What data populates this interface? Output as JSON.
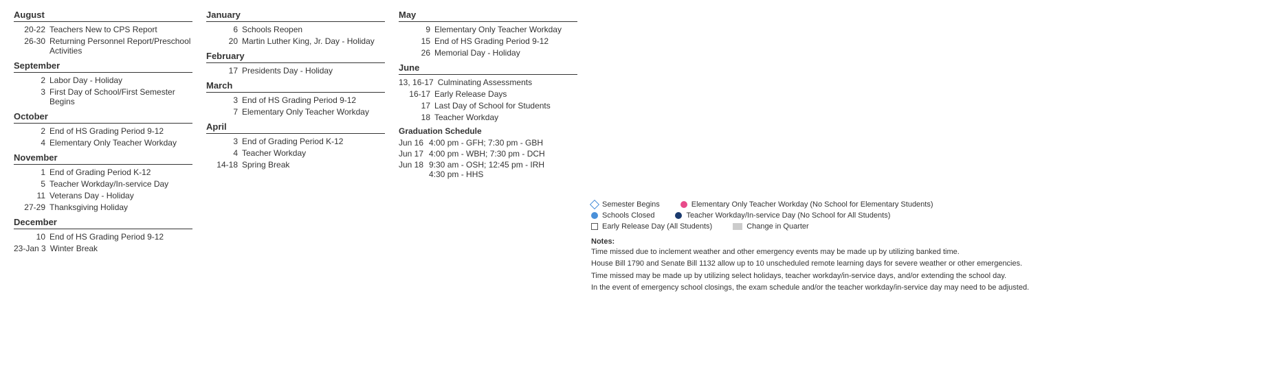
{
  "calendar": {
    "left": {
      "months": [
        {
          "name": "August",
          "events": [
            {
              "date": "20-22",
              "desc": "Teachers New to CPS Report"
            },
            {
              "date": "26-30",
              "desc": "Returning Personnel Report/Preschool Activities"
            }
          ]
        },
        {
          "name": "September",
          "events": [
            {
              "date": "2",
              "desc": "Labor Day - Holiday"
            },
            {
              "date": "3",
              "desc": "First Day of School/First Semester Begins"
            }
          ]
        },
        {
          "name": "October",
          "events": [
            {
              "date": "2",
              "desc": "End of HS Grading Period 9-12"
            },
            {
              "date": "4",
              "desc": "Elementary Only Teacher Workday"
            }
          ]
        },
        {
          "name": "November",
          "events": [
            {
              "date": "1",
              "desc": "End of Grading Period K-12"
            },
            {
              "date": "5",
              "desc": "Teacher Workday/In-service Day"
            },
            {
              "date": "11",
              "desc": "Veterans Day - Holiday"
            },
            {
              "date": "27-29",
              "desc": "Thanksgiving Holiday"
            }
          ]
        },
        {
          "name": "December",
          "events": [
            {
              "date": "10",
              "desc": "End of HS Grading Period 9-12"
            },
            {
              "date": "23-Jan 3",
              "desc": "Winter Break"
            }
          ]
        }
      ]
    },
    "mid": {
      "months": [
        {
          "name": "January",
          "events": [
            {
              "date": "6",
              "desc": "Schools Reopen"
            },
            {
              "date": "20",
              "desc": "Martin Luther King, Jr. Day - Holiday"
            }
          ]
        },
        {
          "name": "February",
          "events": [
            {
              "date": "17",
              "desc": "Presidents Day - Holiday"
            }
          ]
        },
        {
          "name": "March",
          "events": [
            {
              "date": "3",
              "desc": "End of HS Grading Period 9-12"
            },
            {
              "date": "7",
              "desc": "Elementary Only Teacher Workday"
            }
          ]
        },
        {
          "name": "April",
          "events": [
            {
              "date": "3",
              "desc": "End of Grading Period K-12"
            },
            {
              "date": "4",
              "desc": "Teacher Workday"
            },
            {
              "date": "14-18",
              "desc": "Spring Break"
            }
          ]
        }
      ]
    },
    "right": {
      "months": [
        {
          "name": "May",
          "events": [
            {
              "date": "9",
              "desc": "Elementary Only Teacher Workday"
            },
            {
              "date": "15",
              "desc": "End of HS Grading Period 9-12"
            },
            {
              "date": "26",
              "desc": "Memorial Day - Holiday"
            }
          ]
        },
        {
          "name": "June",
          "events": [
            {
              "date": "13, 16-17",
              "desc": "Culminating Assessments"
            },
            {
              "date": "16-17",
              "desc": "Early Release Days"
            },
            {
              "date": "17",
              "desc": "Last Day of School for Students"
            },
            {
              "date": "18",
              "desc": "Teacher Workday"
            }
          ]
        }
      ],
      "graduation": {
        "header": "Graduation Schedule",
        "items": [
          {
            "date": "Jun 16",
            "desc": "4:00 pm - GFH; 7:30 pm - GBH"
          },
          {
            "date": "Jun 17",
            "desc": "4:00 pm - WBH; 7:30 pm - DCH"
          },
          {
            "date": "Jun 18",
            "desc": "9:30 am - OSH; 12:45 pm - IRH\n4:30 pm - HHS"
          }
        ]
      }
    }
  },
  "legend": {
    "items": [
      {
        "icon": "diamond",
        "label": "Semester Begins"
      },
      {
        "icon": "circle-blue",
        "label": "Schools Closed"
      },
      {
        "icon": "square",
        "label": "Early Release Day (All Students)"
      },
      {
        "icon": "circle-pink",
        "label": "Elementary Only Teacher Workday (No School for Elementary Students)"
      },
      {
        "icon": "circle-darkblue",
        "label": "Teacher Workday/In-service Day (No School for All Students)"
      },
      {
        "icon": "rect-gray",
        "label": "Change in Quarter"
      }
    ]
  },
  "notes": {
    "title": "Notes:",
    "lines": [
      "Time missed due to inclement weather and other emergency events may be made up by utilizing banked time.",
      "House Bill 1790 and Senate Bill 1132 allow up to 10 unscheduled remote learning days for severe weather or other emergencies.",
      "Time missed may be made up by utilizing select holidays, teacher workday/in-service days, and/or extending the school day.",
      "In the event of emergency school closings, the exam schedule and/or the teacher workday/in-service day may need to be adjusted."
    ]
  }
}
